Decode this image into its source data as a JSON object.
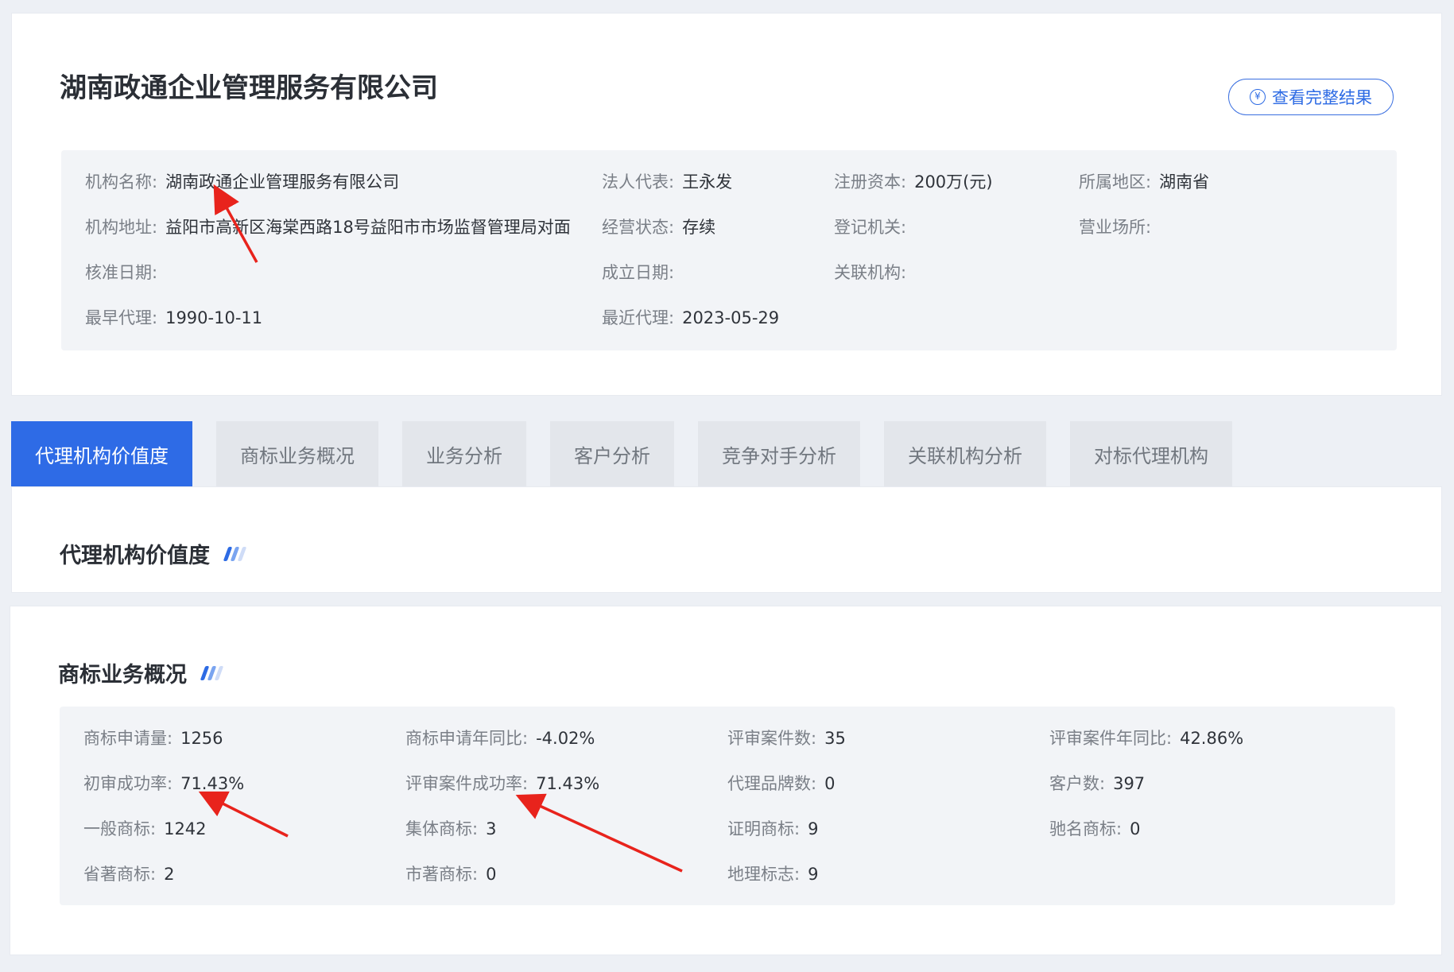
{
  "company": {
    "title": "湖南政通企业管理服务有限公司",
    "view_button_label": "查看完整结果",
    "view_button_icon": "¥"
  },
  "info": {
    "org_name_label": "机构名称:",
    "org_name_value": "湖南政通企业管理服务有限公司",
    "legal_rep_label": "法人代表:",
    "legal_rep_value": "王永发",
    "capital_label": "注册资本:",
    "capital_value": "200万(元)",
    "region_label": "所属地区:",
    "region_value": "湖南省",
    "address_label": "机构地址:",
    "address_value": "益阳市高新区海棠西路18号益阳市市场监督管理局对面",
    "status_label": "经营状态:",
    "status_value": "存续",
    "reg_authority_label": "登记机关:",
    "premises_label": "营业场所:",
    "approval_date_label": "核准日期:",
    "founded_label": "成立日期:",
    "related_org_label": "关联机构:",
    "earliest_agent_label": "最早代理:",
    "earliest_agent_value": "1990-10-11",
    "latest_agent_label": "最近代理:",
    "latest_agent_value": "2023-05-29"
  },
  "tabs": [
    {
      "label": "代理机构价值度",
      "active": true
    },
    {
      "label": "商标业务概况",
      "active": false
    },
    {
      "label": "业务分析",
      "active": false
    },
    {
      "label": "客户分析",
      "active": false
    },
    {
      "label": "竞争对手分析",
      "active": false
    },
    {
      "label": "关联机构分析",
      "active": false
    },
    {
      "label": "对标代理机构",
      "active": false
    }
  ],
  "sections": {
    "value_title": "代理机构价值度",
    "trademark_title": "商标业务概况"
  },
  "stats": {
    "applications_label": "商标申请量:",
    "applications_value": "1256",
    "app_yoy_label": "商标申请年同比:",
    "app_yoy_value": "-4.02%",
    "review_cases_label": "评审案件数:",
    "review_cases_value": "35",
    "review_yoy_label": "评审案件年同比:",
    "review_yoy_value": "42.86%",
    "initial_success_label": "初审成功率:",
    "initial_success_value": "71.43%",
    "review_success_label": "评审案件成功率:",
    "review_success_value": "71.43%",
    "brands_label": "代理品牌数:",
    "brands_value": "0",
    "clients_label": "客户数:",
    "clients_value": "397",
    "general_label": "一般商标:",
    "general_value": "1242",
    "collective_label": "集体商标:",
    "collective_value": "3",
    "certification_label": "证明商标:",
    "certification_value": "9",
    "wellknown_label": "驰名商标:",
    "wellknown_value": "0",
    "provincial_label": "省著商标:",
    "provincial_value": "2",
    "municipal_label": "市著商标:",
    "municipal_value": "0",
    "geo_label": "地理标志:",
    "geo_value": "9"
  },
  "colors": {
    "accent": "#2e6be6",
    "annotation": "#e8231c"
  }
}
